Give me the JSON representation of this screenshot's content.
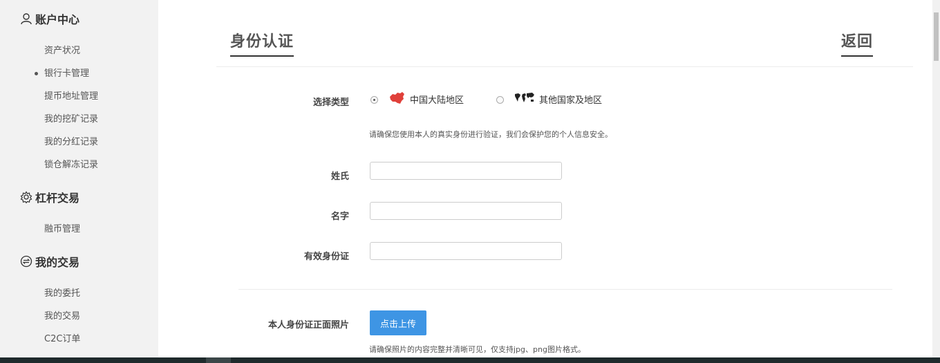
{
  "sidebar": {
    "groups": [
      {
        "title": "账户中心",
        "icon": "user-icon",
        "items": [
          {
            "label": "资产状况",
            "active": false
          },
          {
            "label": "银行卡管理",
            "active": true
          },
          {
            "label": "提币地址管理",
            "active": false
          },
          {
            "label": "我的挖矿记录",
            "active": false
          },
          {
            "label": "我的分红记录",
            "active": false
          },
          {
            "label": "锁仓解冻记录",
            "active": false
          }
        ]
      },
      {
        "title": "杠杆交易",
        "icon": "gear-icon",
        "items": [
          {
            "label": "融币管理",
            "active": false
          }
        ]
      },
      {
        "title": "我的交易",
        "icon": "exchange-icon",
        "items": [
          {
            "label": "我的委托",
            "active": false
          },
          {
            "label": "我的交易",
            "active": false
          },
          {
            "label": "C2C订单",
            "active": false
          }
        ]
      }
    ]
  },
  "page": {
    "title": "身份认证",
    "back_label": "返回"
  },
  "form": {
    "type_label": "选择类型",
    "options": [
      {
        "label": "中国大陆地区",
        "icon": "china-map-icon",
        "selected": true
      },
      {
        "label": "其他国家及地区",
        "icon": "world-map-icon",
        "selected": false
      }
    ],
    "type_hint": "请确保您使用本人的真实身份进行验证，我们会保护您的个人信息安全。",
    "surname_label": "姓氏",
    "surname_value": "",
    "given_name_label": "名字",
    "given_name_value": "",
    "id_label": "有效身份证",
    "id_value": "",
    "upload_label": "本人身份证正面照片",
    "upload_button": "点击上传",
    "upload_hint": "请确保照片的内容完整并清晰可见，仅支持jpg、png图片格式。"
  },
  "colors": {
    "sidebar_bg": "#f2f2f2",
    "primary_button": "#3e95e4",
    "china_map": "#e0403a"
  }
}
